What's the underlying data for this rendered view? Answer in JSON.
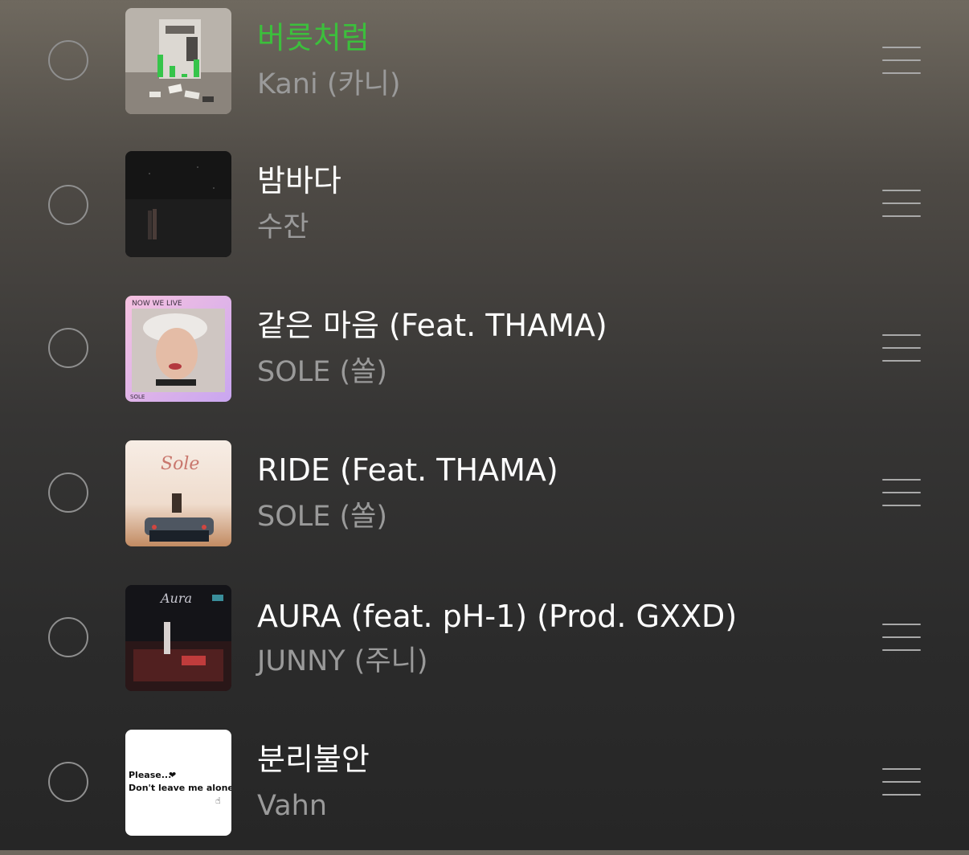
{
  "tracks": [
    {
      "title": "버릇처럼",
      "artist": "Kani (카니)",
      "playing": true,
      "cover_icon": "album-cover-kani"
    },
    {
      "title": "밤바다",
      "artist": "수잔",
      "playing": false,
      "cover_icon": "album-cover-night-sea"
    },
    {
      "title": "같은 마음 (Feat. THAMA)",
      "artist": "SOLE (쏠)",
      "playing": false,
      "cover_icon": "album-cover-now-we-live",
      "cover_text": "NOW WE LIVE",
      "cover_footer": "SOLE"
    },
    {
      "title": "RIDE (Feat. THAMA)",
      "artist": "SOLE (쏠)",
      "playing": false,
      "cover_icon": "album-cover-sole-ride",
      "cover_text": "Sole"
    },
    {
      "title": "AURA (feat. pH-1) (Prod. GXXD)",
      "artist": "JUNNY (주니)",
      "playing": false,
      "cover_icon": "album-cover-aura",
      "cover_text": "Aura"
    },
    {
      "title": "분리불안",
      "artist": "Vahn",
      "playing": false,
      "cover_icon": "album-cover-please",
      "cover_line1": "Please...",
      "cover_line2": "Don't leave me alone"
    }
  ],
  "colors": {
    "playing": "#3cbf3c",
    "title": "#ffffff",
    "artist": "#9a9a9a",
    "control": "#8f8f8f"
  }
}
